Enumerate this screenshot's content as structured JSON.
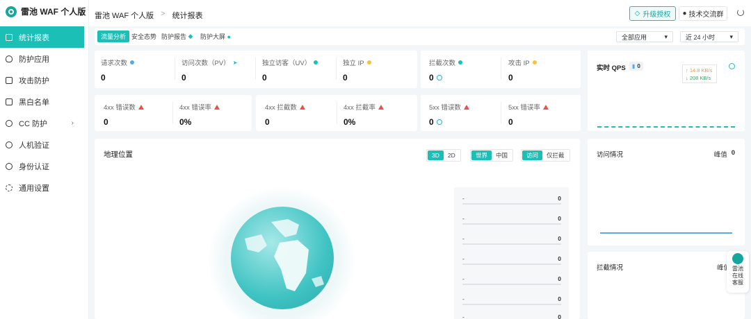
{
  "app": {
    "logo_text": "雷池 WAF 个人版"
  },
  "breadcrumb": {
    "root": "雷池 WAF 个人版",
    "current": "统计报表",
    "separator": ">"
  },
  "header": {
    "upgrade_label": "升级授权",
    "tech_label": "技术交流群"
  },
  "sidebar": {
    "items": [
      {
        "label": "统计报表",
        "icon": "chart-icon",
        "active": true
      },
      {
        "label": "防护应用",
        "icon": "shield-icon"
      },
      {
        "label": "攻击防护",
        "icon": "document-icon"
      },
      {
        "label": "黑白名单",
        "icon": "list-icon"
      },
      {
        "label": "CC 防护",
        "icon": "tool-icon",
        "has_children": true
      },
      {
        "label": "人机验证",
        "icon": "user-icon"
      },
      {
        "label": "身份认证",
        "icon": "key-icon"
      },
      {
        "label": "通用设置",
        "icon": "gear-icon"
      }
    ]
  },
  "tabs": [
    "流量分析",
    "安全态势",
    "防护报告",
    "防护大屏"
  ],
  "filters": {
    "app_select": "全部应用",
    "time_select": "近 24 小时"
  },
  "metrics_row1": [
    {
      "label": "请求次数",
      "value": "0"
    },
    {
      "label": "访问次数（PV）",
      "value": "0"
    },
    {
      "label": "独立访客（UV）",
      "value": "0"
    },
    {
      "label": "独立 IP",
      "value": "0"
    }
  ],
  "metrics_row1b": [
    {
      "label": "拦截次数",
      "value": "0"
    },
    {
      "label": "攻击 IP",
      "value": "0"
    }
  ],
  "metrics_row2": [
    {
      "label": "4xx 错误数",
      "value": "0"
    },
    {
      "label": "4xx 错误率",
      "value": "0%"
    },
    {
      "label": "4xx 拦截数",
      "value": "0"
    },
    {
      "label": "4xx 拦截率",
      "value": "0%"
    }
  ],
  "metrics_row2b": [
    {
      "label": "5xx 错误数",
      "value": "0"
    },
    {
      "label": "5xx 错误率",
      "value": "0"
    }
  ],
  "qps": {
    "title": "实时 QPS",
    "badge": "0",
    "up": "↑ 14.8 KB/s",
    "down": "↓ 208 KB/s"
  },
  "geo": {
    "title": "地理位置",
    "mode_3d": "3D",
    "mode_2d": "2D",
    "world": "世界",
    "china": "中国",
    "visit": "访问",
    "intercept_only": "仅拦截",
    "rank": [
      {
        "name": "-",
        "value": "0"
      },
      {
        "name": "-",
        "value": "0"
      },
      {
        "name": "-",
        "value": "0"
      },
      {
        "name": "-",
        "value": "0"
      },
      {
        "name": "-",
        "value": "0"
      },
      {
        "name": "-",
        "value": "0"
      },
      {
        "name": "-",
        "value": "0"
      }
    ]
  },
  "visits": {
    "title": "访问情况",
    "peak_label": "峰值",
    "peak_value": "0"
  },
  "intercepts": {
    "title": "拦截情况",
    "peak_label": "峰值"
  },
  "support": {
    "line1": "雷池",
    "line2": "在线",
    "line3": "客服"
  },
  "colors": {
    "accent": "#1bbfb6",
    "warn": "#e5534b",
    "up": "#e89a3c",
    "down": "#3aa55d"
  }
}
